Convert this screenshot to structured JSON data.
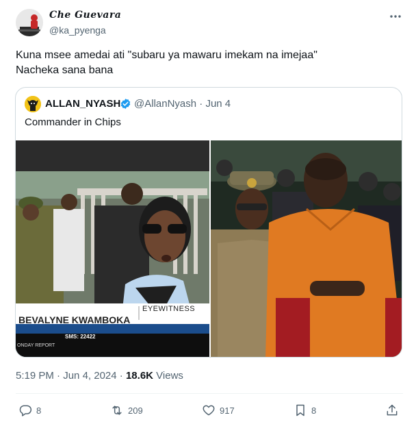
{
  "author": {
    "display_name": "Che Guevara",
    "handle": "@ka_pyenga"
  },
  "tweet": {
    "lines": [
      "Kuna msee amedai ati \"subaru ya mawaru imekam na imejaa\"",
      "Nacheka sana bana"
    ],
    "time": "5:19 PM",
    "date": "Jun 4, 2024",
    "views_count": "18.6K",
    "views_label": "Views"
  },
  "quoted": {
    "display_name": "ALLAN_NYASH",
    "handle": "@AllanNyash",
    "date": "Jun 4",
    "text": "Commander in Chips",
    "images": {
      "left": {
        "lower_third_name": "BEVALYNE KWAMBOKA",
        "lower_third_tag": "EYEWITNESS",
        "ticker_program": "ONDAY REPORT",
        "ticker_sms": "SMS: 22422"
      }
    }
  },
  "actions": {
    "replies": "8",
    "reposts": "209",
    "likes": "917",
    "bookmarks": "8"
  },
  "colors": {
    "text_primary": "#0f1419",
    "text_secondary": "#536471",
    "border": "#cfd9de",
    "verified": "#1d9bf0"
  }
}
